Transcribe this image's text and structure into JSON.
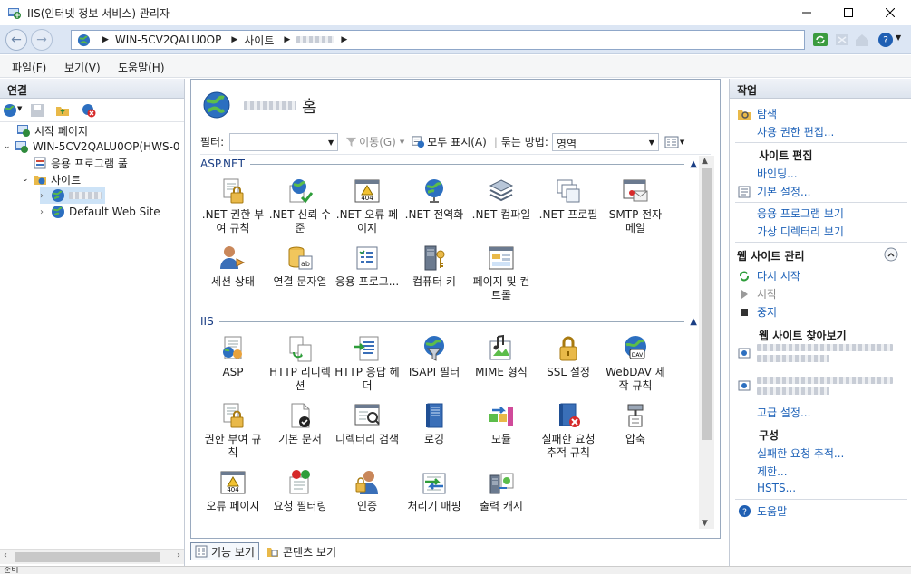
{
  "window": {
    "title": "IIS(인터넷 정보 서비스) 관리자",
    "status": "준비"
  },
  "address": {
    "crumbs": [
      "WIN-5CV2QALU0OP",
      "사이트"
    ]
  },
  "menu": [
    "파일(F)",
    "보기(V)",
    "도움말(H)"
  ],
  "connections": {
    "header": "연결",
    "tree": {
      "start_page": "시작 페이지",
      "server": "WIN-5CV2QALU0OP(HWS-0",
      "app_pools": "응용 프로그램 풀",
      "sites": "사이트",
      "default_site": "Default Web Site"
    }
  },
  "home": {
    "title_suffix": "홈",
    "filter_label": "필터:",
    "go_label": "이동(G)",
    "show_all_label": "모두 표시(A)",
    "group_label": "묶는 방법:",
    "group_value": "영역",
    "sections": {
      "aspnet": {
        "name": "ASP.NET",
        "items": [
          ".NET 권한 부여 규칙",
          ".NET 신뢰 수준",
          ".NET 오류 페이지",
          ".NET 전역화",
          ".NET 컴파일",
          ".NET 프로필",
          "SMTP 전자 메일",
          "세션 상태",
          "연결 문자열",
          "응용 프로그...",
          "컴퓨터 키",
          "페이지 및 컨트롤"
        ]
      },
      "iis": {
        "name": "IIS",
        "items": [
          "ASP",
          "HTTP 리디렉션",
          "HTTP 응답 헤더",
          "ISAPI 필터",
          "MIME 형식",
          "SSL 설정",
          "WebDAV 제작 규칙",
          "권한 부여 규칙",
          "기본 문서",
          "디렉터리 검색",
          "로깅",
          "모듈",
          "실패한 요청 추적 규칙",
          "압축",
          "오류 페이지",
          "요청 필터링",
          "인증",
          "처리기 매핑",
          "출력 캐시"
        ]
      }
    }
  },
  "view_tabs": {
    "features": "기능 보기",
    "content": "콘텐츠 보기"
  },
  "actions": {
    "header": "작업",
    "explore": "탐색",
    "edit_permissions": "사용 권한 편집...",
    "site_edit": "사이트 편집",
    "bindings": "바인딩...",
    "basic_settings": "기본 설정...",
    "view_apps": "응용 프로그램 보기",
    "view_vdirs": "가상 디렉터리 보기",
    "manage_site": "웹 사이트 관리",
    "restart": "다시 시작",
    "start": "시작",
    "stop": "중지",
    "browse_site": "웹 사이트 찾아보기",
    "advanced_settings": "고급 설정...",
    "config": "구성",
    "failed_tracing": "실패한 요청 추적...",
    "limits": "제한...",
    "hsts": "HSTS...",
    "help": "도움말"
  },
  "colors": {
    "accent": "#1e62b8",
    "section": "#1a3e84",
    "stop": "#333333",
    "restart": "#2e9d3a"
  }
}
